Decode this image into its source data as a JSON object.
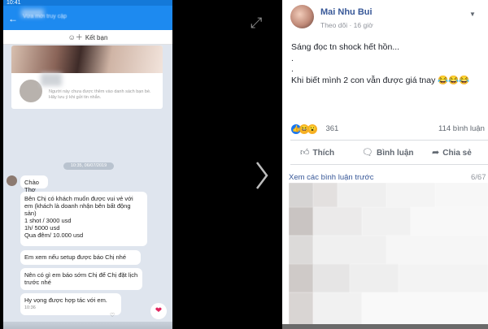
{
  "left_chat": {
    "status_time": "10:41",
    "header_subtitle": "Vừa mới truy cập",
    "add_friend": "Kết bạn",
    "card_note": "Người này chưa được thêm vào danh sách bạn bè. Hãy lưu ý khi gửi tin nhắn.",
    "time_divider": "10:35, 06/07/2019",
    "messages": [
      "Chào Thơ",
      "Bên Chị có khách muốn được vui vẻ với em (khách là doanh nhận bên bất động sản)\n1 shot / 3000 usd\n1h/ 5000 usd\nQua đêm/ 10.000 usd",
      "Em xem nếu setup được báo Chị nhé",
      "Nên có gì em báo sớm Chị để Chị đặt lịch trước nhé",
      "Hy vọng được hợp tác với em."
    ],
    "last_message_time": "10:36"
  },
  "fb_post": {
    "author": "Mai Nhu Bui",
    "follow_label": "Theo dõi",
    "time": "16 giờ",
    "text_lines": [
      "Sáng đọc tn shock hết hồn...",
      ".",
      ".",
      "Khi biết mình 2 con vẫn được giá tnay 😂😂😂"
    ],
    "reaction_count": "361",
    "comment_count": "114 bình luận",
    "actions": {
      "like": "Thích",
      "comment": "Bình luận",
      "share": "Chia sẻ"
    },
    "previous_comments": "Xem các bình luận trước",
    "comment_page": "6/67"
  },
  "icons": {
    "expand": "expand-icon",
    "next": "chevron-right-icon",
    "heart": "heart-icon"
  },
  "colors": {
    "zalo_blue": "#1d8af0",
    "fb_blue": "#385898",
    "heart_red": "#e0245e"
  }
}
